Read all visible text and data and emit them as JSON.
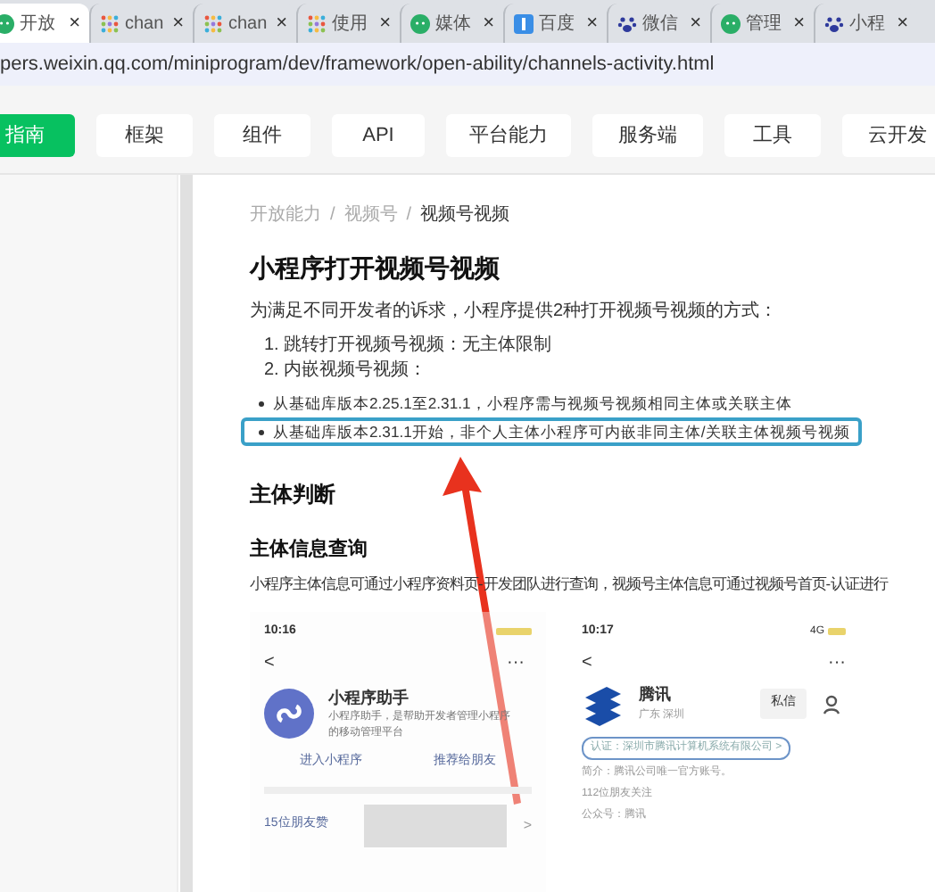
{
  "browser_tabs": [
    {
      "label": "开放",
      "kind": "chat",
      "close": "×",
      "selected": true
    },
    {
      "label": "chan",
      "kind": "dots",
      "close": "×",
      "selected": false
    },
    {
      "label": "chan",
      "kind": "dots",
      "close": "×",
      "selected": false
    },
    {
      "label": "使用",
      "kind": "dots",
      "close": "×",
      "selected": false
    },
    {
      "label": "媒体",
      "kind": "chat",
      "close": "×",
      "selected": false
    },
    {
      "label": "百度",
      "kind": "square",
      "close": "×",
      "selected": false
    },
    {
      "label": "微信",
      "kind": "paw",
      "close": "×",
      "selected": false
    },
    {
      "label": "管理",
      "kind": "chat",
      "close": "×",
      "selected": false
    },
    {
      "label": "小程",
      "kind": "paw",
      "close": "×",
      "selected": false
    }
  ],
  "address_bar": {
    "url": "pers.weixin.qq.com/miniprogram/dev/framework/open-ability/channels-activity.html"
  },
  "nav": [
    {
      "label": "指南",
      "selected": true
    },
    {
      "label": "框架",
      "selected": false
    },
    {
      "label": "组件",
      "selected": false
    },
    {
      "label": "API",
      "selected": false
    },
    {
      "label": "平台能力",
      "selected": false
    },
    {
      "label": "服务端",
      "selected": false
    },
    {
      "label": "工具",
      "selected": false
    },
    {
      "label": "云开发",
      "selected": false
    }
  ],
  "breadcrumb": [
    {
      "kind": "link",
      "text": "开放能力"
    },
    {
      "kind": "separator",
      "text": "/"
    },
    {
      "kind": "link",
      "text": "视频号"
    },
    {
      "kind": "separator",
      "text": "/"
    },
    {
      "kind": "current",
      "text": "视频号视频"
    }
  ],
  "title": "小程序打开视频号视频",
  "intro": "为满足不同开发者的诉求，小程序提供2种打开视频号视频的方式：",
  "ordered_list": [
    "1. 跳转打开视频号视频：无主体限制",
    "2. 内嵌视频号视频："
  ],
  "bullets": [
    {
      "text": "从基础库版本2.25.1至2.31.1，小程序需与视频号视频相同主体或关联主体",
      "highlighted": false
    },
    {
      "text": "从基础库版本2.31.1开始，非个人主体小程序可内嵌非同主体/关联主体视频号视频",
      "highlighted": true
    }
  ],
  "section_title": "主体判断",
  "subsection_title": "主体信息查询",
  "subsection_text": "小程序主体信息可通过小程序资料页-开发团队进行查询，视频号主体信息可通过视频号首页-认证进行",
  "left_phone": {
    "time": "10:16",
    "back": "<",
    "more": "···",
    "name": "小程序助手",
    "description": "小程序助手，是帮助开发者管理小程序的移动管理平台",
    "buttons": [
      "进入小程序",
      "推荐给朋友"
    ],
    "likes": "15位朋友赞",
    "chevron": ">"
  },
  "right_phone": {
    "time": "10:17",
    "network": "4G",
    "back": "<",
    "more": "···",
    "name": "腾讯",
    "location": "广东 深圳",
    "message_button": "私信",
    "verification": "认证：深圳市腾讯计算机系统有限公司 >",
    "intro": "简介：腾讯公司唯一官方账号。",
    "followers": "112位朋友关注",
    "official_account": "公众号：腾讯"
  }
}
